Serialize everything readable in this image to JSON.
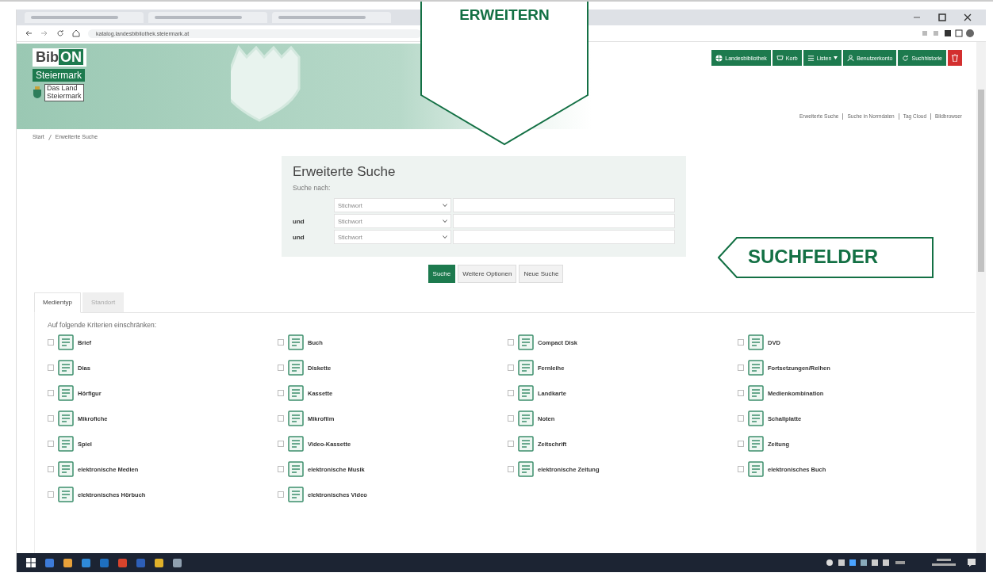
{
  "browser": {
    "url": "katalog.landesbibliothek.steiermark.at"
  },
  "header": {
    "logo_a": "Bib",
    "logo_b": "ON",
    "region": "Steiermark",
    "land": "Das Land",
    "land2": "Steiermark",
    "nav": [
      {
        "label": "Landesbibliothek",
        "kind": "globe"
      },
      {
        "label": "Korb",
        "kind": "basket"
      },
      {
        "label": "Listen",
        "kind": "list"
      },
      {
        "label": "Benutzerkonto",
        "kind": "user"
      },
      {
        "label": "Suchhistorie",
        "kind": "history"
      },
      {
        "kind": "trash"
      }
    ],
    "links": [
      "Erweiterte Suche",
      "Suche in Normdaten",
      "Tag Cloud",
      "Bildbrowser"
    ]
  },
  "breadcrumb": [
    "Start",
    "Erweiterte Suche"
  ],
  "search": {
    "title": "Erweiterte Suche",
    "subtitle": "Suche nach:",
    "rows": [
      {
        "field": "Stichwort"
      },
      {
        "connector": "und",
        "field": "Stichwort"
      },
      {
        "connector": "und",
        "field": "Stichwort"
      }
    ],
    "buttons": [
      {
        "label": "Suche",
        "primary": true
      },
      {
        "label": "Weitere Optionen",
        "primary": false
      },
      {
        "label": "Neue Suche",
        "primary": false
      }
    ]
  },
  "tabs": [
    {
      "label": "Medientyp",
      "selected": true
    },
    {
      "label": "Standort",
      "selected": false
    }
  ],
  "filter_title": "Auf folgende Kriterien einschränken:",
  "media": [
    {
      "label": "Brief",
      "checked": false
    },
    {
      "label": "Buch",
      "checked": false
    },
    {
      "label": "Compact Disk",
      "checked": false
    },
    {
      "label": "DVD",
      "checked": false
    },
    {
      "label": "Dias",
      "checked": false
    },
    {
      "label": "Diskette",
      "checked": false
    },
    {
      "label": "Fernleihe",
      "checked": false
    },
    {
      "label": "Fortsetzungen/Reihen",
      "checked": false
    },
    {
      "label": "Hörfigur",
      "checked": false
    },
    {
      "label": "Kassette",
      "checked": false
    },
    {
      "label": "Landkarte",
      "checked": false
    },
    {
      "label": "Medienkombination",
      "checked": false
    },
    {
      "label": "Mikrofiche",
      "checked": false
    },
    {
      "label": "Mikrofilm",
      "checked": false
    },
    {
      "label": "Noten",
      "checked": false
    },
    {
      "label": "Schallplatte",
      "checked": false
    },
    {
      "label": "Spiel",
      "checked": false
    },
    {
      "label": "Video-Kassette",
      "checked": false
    },
    {
      "label": "Zeitschrift",
      "checked": false
    },
    {
      "label": "Zeitung",
      "checked": false
    },
    {
      "label": "elektronische Medien",
      "checked": false
    },
    {
      "label": "elektronische Musik",
      "checked": false
    },
    {
      "label": "elektronische Zeitung",
      "checked": false
    },
    {
      "label": "elektronisches Buch",
      "checked": false
    },
    {
      "label": "elektronisches Hörbuch",
      "checked": false
    },
    {
      "label": "elektronisches Video",
      "checked": false
    }
  ],
  "callouts": [
    {
      "label": "ERWEITERN",
      "kind": "down"
    },
    {
      "label": "SUCHFELDER",
      "kind": "left"
    }
  ]
}
